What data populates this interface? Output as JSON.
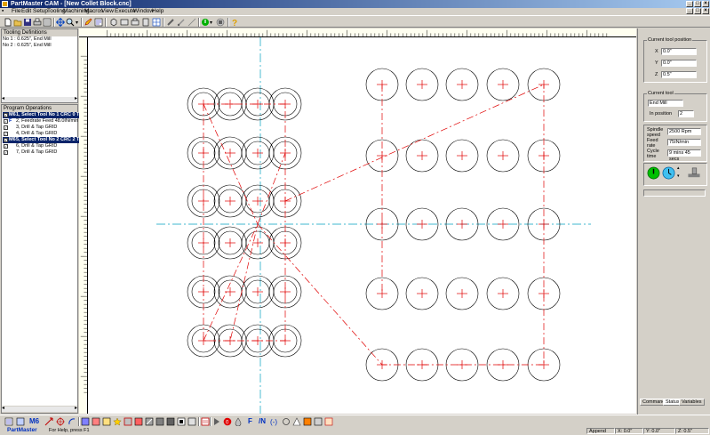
{
  "window": {
    "title": "PartMaster CAM - [New Collet Block.cnc]"
  },
  "menu": [
    "File",
    "Edit",
    "Setup",
    "Tooling",
    "Machining",
    "Macros",
    "View",
    "Execute",
    "Window",
    "Help"
  ],
  "tooling": {
    "header": "Tooling Definitions",
    "items": [
      "No 1 : 0.625\", End Mill",
      "No 2 : 0.625\", End Mill"
    ]
  },
  "operations": {
    "header": "Program Operations",
    "items": [
      {
        "tag": "M6",
        "text": "1, Select Tool No 1 CRC 0 TLC",
        "selected": true
      },
      {
        "tag": "F",
        "text": "2, Feedrate Feed 48.0IN/min",
        "selected": false
      },
      {
        "tag": "",
        "text": "3, Drill & Tap GRID",
        "selected": false
      },
      {
        "tag": "",
        "text": "4, Drill & Tap GRID",
        "selected": false
      },
      {
        "tag": "M6",
        "text": "5, Select Tool No 2 CRC 2 TLC",
        "selected": true
      },
      {
        "tag": "",
        "text": "6, Drill & Tap GRID",
        "selected": false
      },
      {
        "tag": "",
        "text": "7, Drill & Tap GRID",
        "selected": false
      }
    ]
  },
  "tool_position": {
    "legend": "Current tool position",
    "x_label": "X",
    "x_value": "0.0\"",
    "y_label": "Y",
    "y_value": "0.0\"",
    "z_label": "Z",
    "z_value": "0.5\""
  },
  "current_tool": {
    "legend": "Current tool",
    "name": "End Mill",
    "in_position_label": "In position",
    "in_position_value": "2"
  },
  "spindle": {
    "speed_label": "Spindle speed",
    "speed_value": "2500 Rpm",
    "feed_label": "Feed rate",
    "feed_value": "75IN/min",
    "cycle_label": "Cycle time",
    "cycle_value": "9 mins 45 secs"
  },
  "tabs": [
    "Command",
    "Status",
    "Variables"
  ],
  "bottom_toolbar": {
    "m6_label": "M6",
    "f_label": "F",
    "n_label": "/N"
  },
  "status": {
    "app_name": "PartMaster",
    "help": "For Help, press F1",
    "mode": "Append",
    "x": "X: 0.0\"",
    "y": "Y: 0.0\"",
    "z": "Z: 0.5\""
  },
  "colors": {
    "toolpath": "#e00000",
    "centerline": "#00a0c0",
    "selection": "#0a246a",
    "accent_green": "#00b000"
  }
}
